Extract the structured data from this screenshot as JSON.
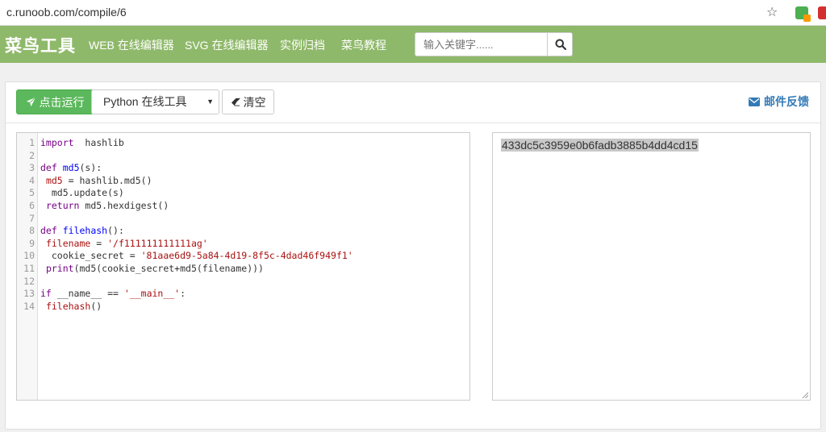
{
  "browser": {
    "url": "c.runoob.com/compile/6"
  },
  "header": {
    "brand": "菜鸟工具",
    "nav": [
      "WEB 在线编辑器",
      "SVG 在线编辑器",
      "实例归档",
      "菜鸟教程"
    ],
    "search_placeholder": "输入关键字......"
  },
  "toolbar": {
    "run_label": "点击运行",
    "language": "Python 在线工具",
    "clear_label": "清空",
    "feedback_label": "邮件反馈"
  },
  "editor": {
    "lines": [
      {
        "n": "1",
        "tokens": [
          [
            "kw",
            "import"
          ],
          [
            "",
            "  hashlib"
          ]
        ]
      },
      {
        "n": "2",
        "tokens": []
      },
      {
        "n": "3",
        "tokens": [
          [
            "kw",
            "def"
          ],
          [
            "",
            " "
          ],
          [
            "def",
            "md5"
          ],
          [
            "",
            "(s):"
          ]
        ]
      },
      {
        "n": "4",
        "tokens": [
          [
            "",
            " "
          ],
          [
            "var",
            "md5"
          ],
          [
            "",
            " = hashlib.md5()"
          ]
        ]
      },
      {
        "n": "5",
        "tokens": [
          [
            "",
            "  md5.update(s)"
          ]
        ]
      },
      {
        "n": "6",
        "tokens": [
          [
            "",
            " "
          ],
          [
            "kw",
            "return"
          ],
          [
            "",
            " md5.hexdigest()"
          ]
        ]
      },
      {
        "n": "7",
        "tokens": []
      },
      {
        "n": "8",
        "tokens": [
          [
            "kw",
            "def"
          ],
          [
            "",
            " "
          ],
          [
            "def",
            "filehash"
          ],
          [
            "",
            "():"
          ]
        ]
      },
      {
        "n": "9",
        "tokens": [
          [
            "",
            " "
          ],
          [
            "var",
            "filename"
          ],
          [
            "",
            " = "
          ],
          [
            "str",
            "'/f111111111111ag'"
          ]
        ]
      },
      {
        "n": "10",
        "tokens": [
          [
            "",
            "  cookie_secret = "
          ],
          [
            "str",
            "'81aae6d9-5a84-4d19-8f5c-4dad46f949f1'"
          ]
        ]
      },
      {
        "n": "11",
        "tokens": [
          [
            "",
            " "
          ],
          [
            "kw",
            "print"
          ],
          [
            "",
            "(md5(cookie_secret+md5(filename)))"
          ]
        ]
      },
      {
        "n": "12",
        "tokens": []
      },
      {
        "n": "13",
        "tokens": [
          [
            "kw",
            "if"
          ],
          [
            "",
            " __name__ == "
          ],
          [
            "str",
            "'__main__'"
          ],
          [
            "",
            ":"
          ]
        ]
      },
      {
        "n": "14",
        "tokens": [
          [
            "",
            " "
          ],
          [
            "var",
            "filehash"
          ],
          [
            "",
            "()"
          ]
        ]
      }
    ]
  },
  "output": {
    "text": "433dc5c3959e0b6fadb3885b4dd4cd15"
  },
  "icons": {
    "run": "paper-plane-icon",
    "clear": "eraser-icon",
    "feedback": "envelope-icon",
    "search": "search-icon",
    "bookmark": "star-icon"
  },
  "colors": {
    "header_bg": "#8fb96a",
    "run_button": "#5cb85c",
    "feedback_link": "#337ab7"
  }
}
